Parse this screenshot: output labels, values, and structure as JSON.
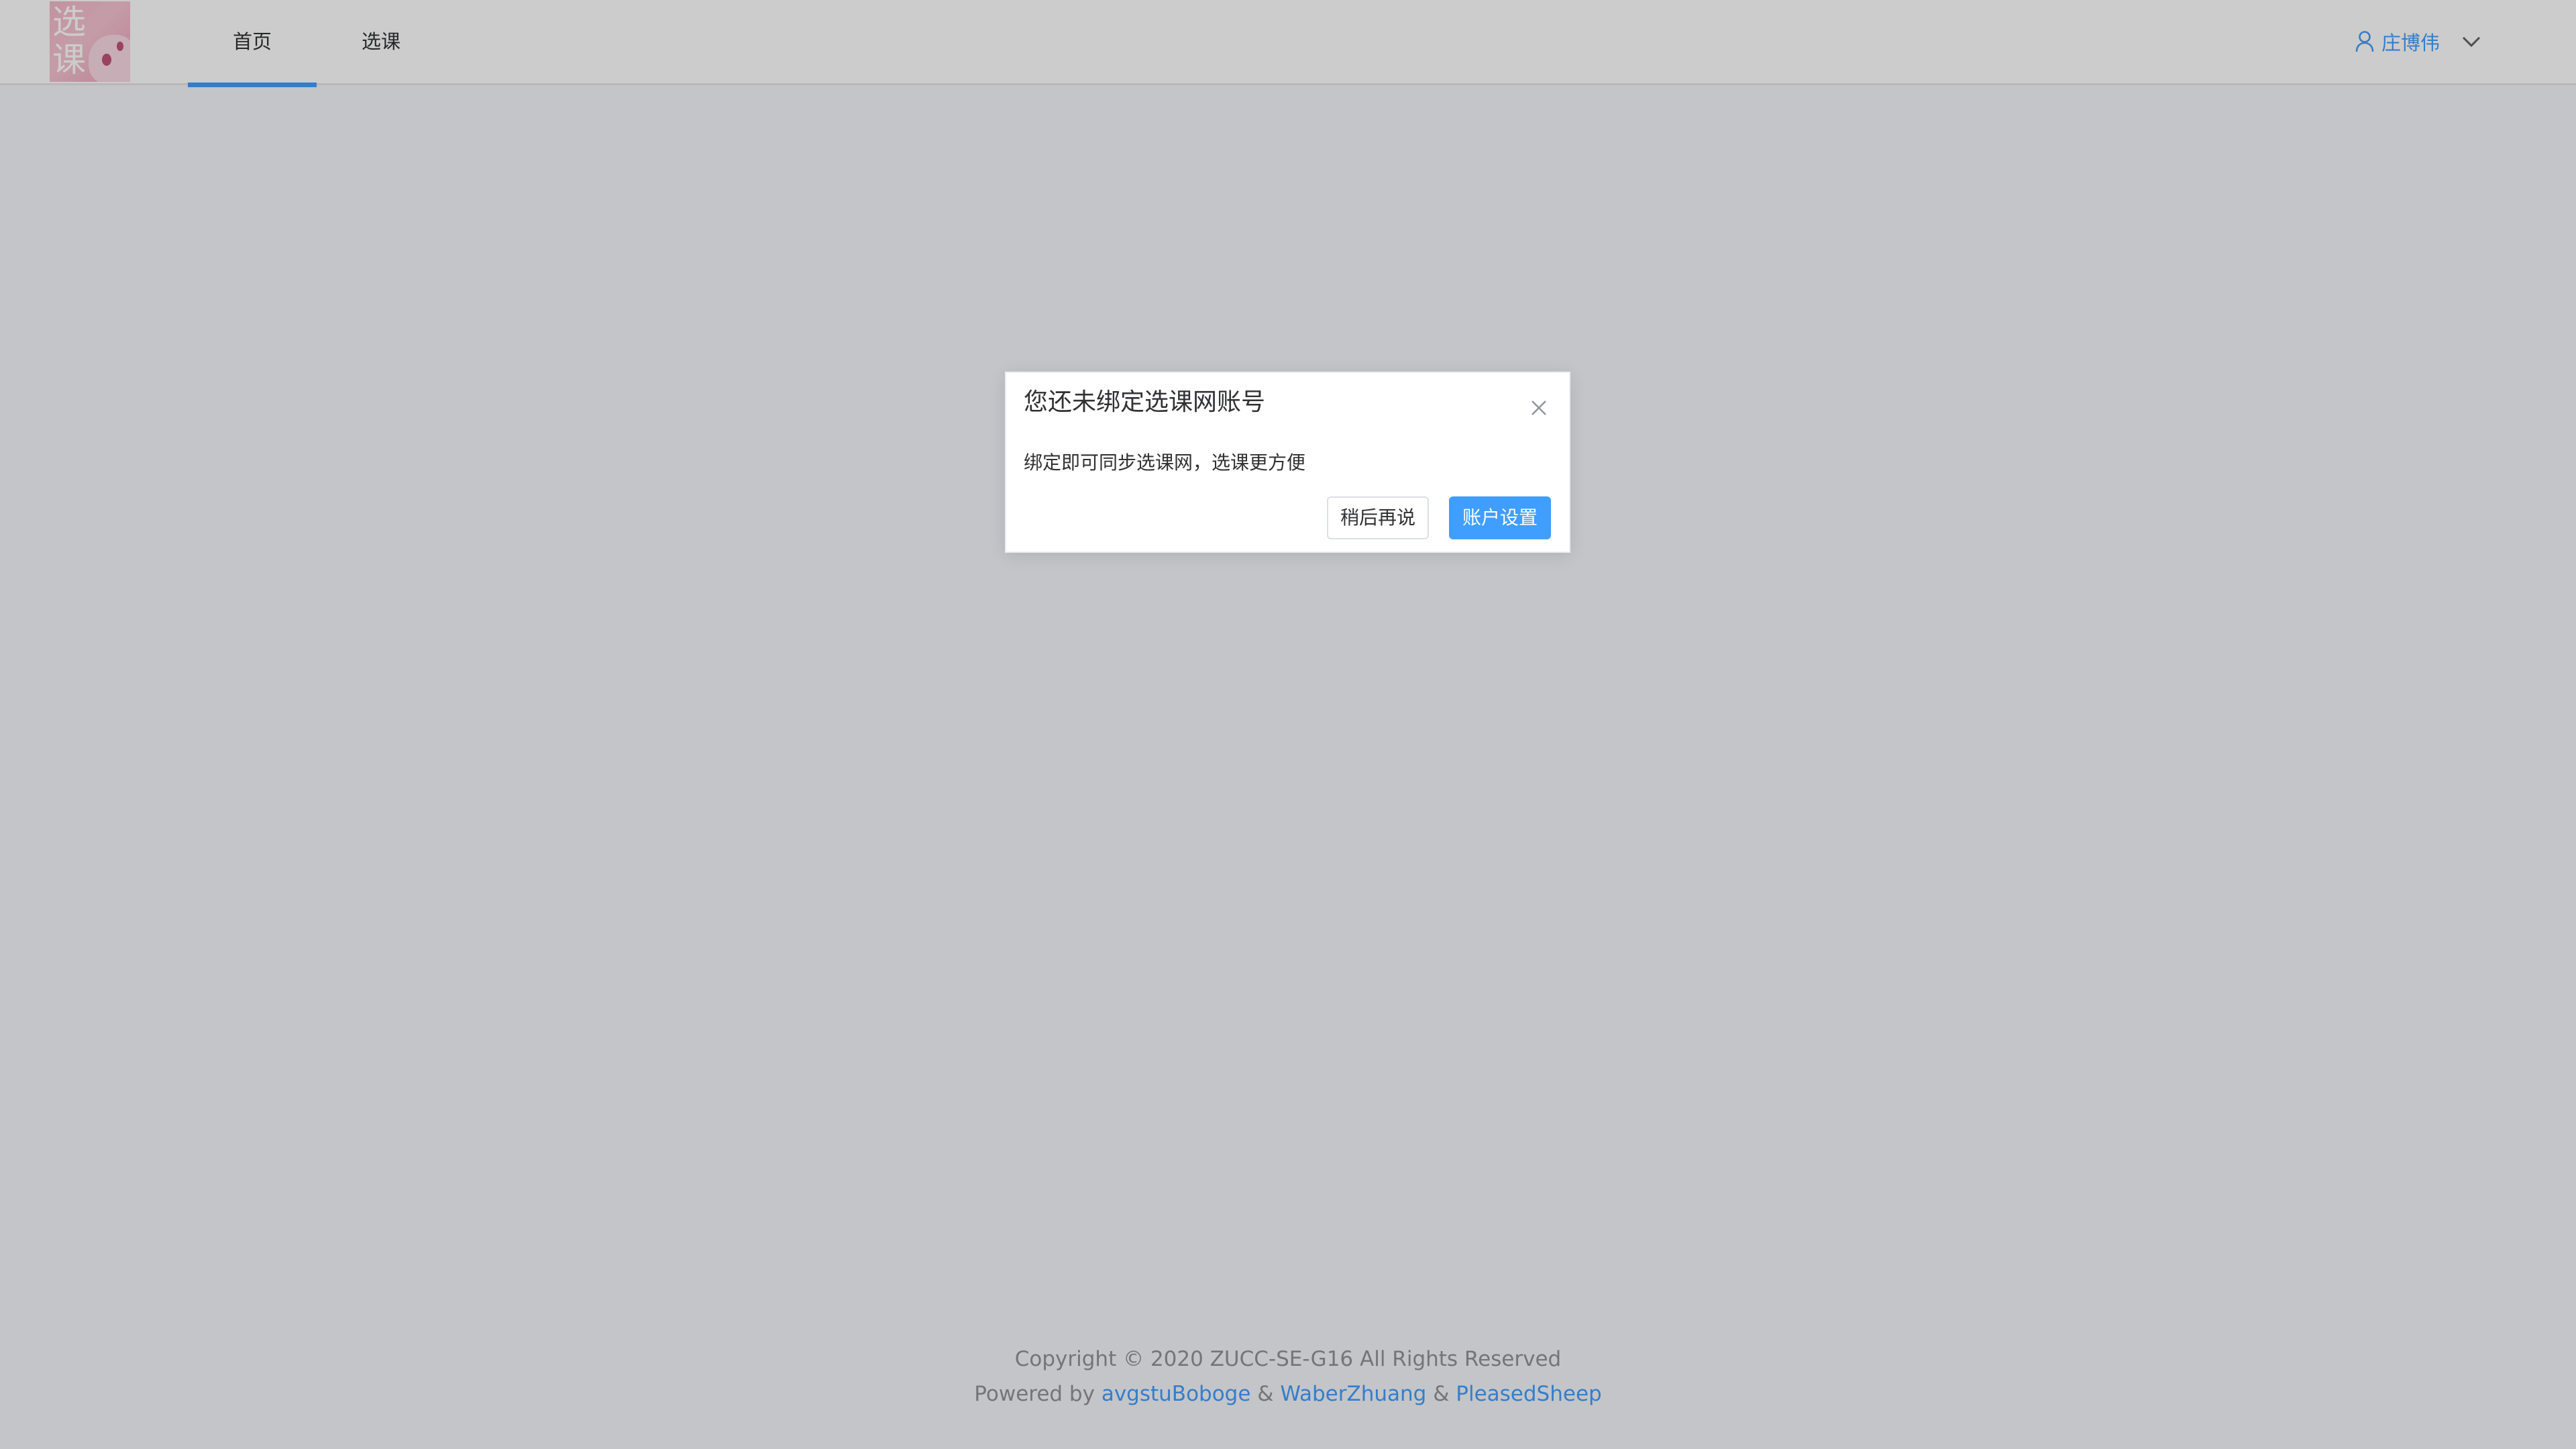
{
  "header": {
    "logo_text": [
      "选",
      "课"
    ],
    "nav": [
      {
        "label": "首页",
        "active": true
      },
      {
        "label": "选课",
        "active": false
      }
    ],
    "user": {
      "name": "庄博伟",
      "icon": "user-icon",
      "dropdown_icon": "chevron-down-icon"
    }
  },
  "dialog": {
    "title": "您还未绑定选课网账号",
    "message": "绑定即可同步选课网，选课更方便",
    "close_icon": "close-icon",
    "cancel_label": "稍后再说",
    "confirm_label": "账户设置"
  },
  "footer": {
    "copyright": "Copyright © 2020 ZUCC-SE-G16 All Rights Reserved",
    "powered_prefix": "Powered by",
    "separator": "&",
    "authors": [
      "avgstuBoboge",
      "WaberZhuang",
      "PleasedSheep"
    ]
  },
  "colors": {
    "primary": "#409eff",
    "text": "#303133",
    "muted": "#909399",
    "overlay": "#000000"
  }
}
